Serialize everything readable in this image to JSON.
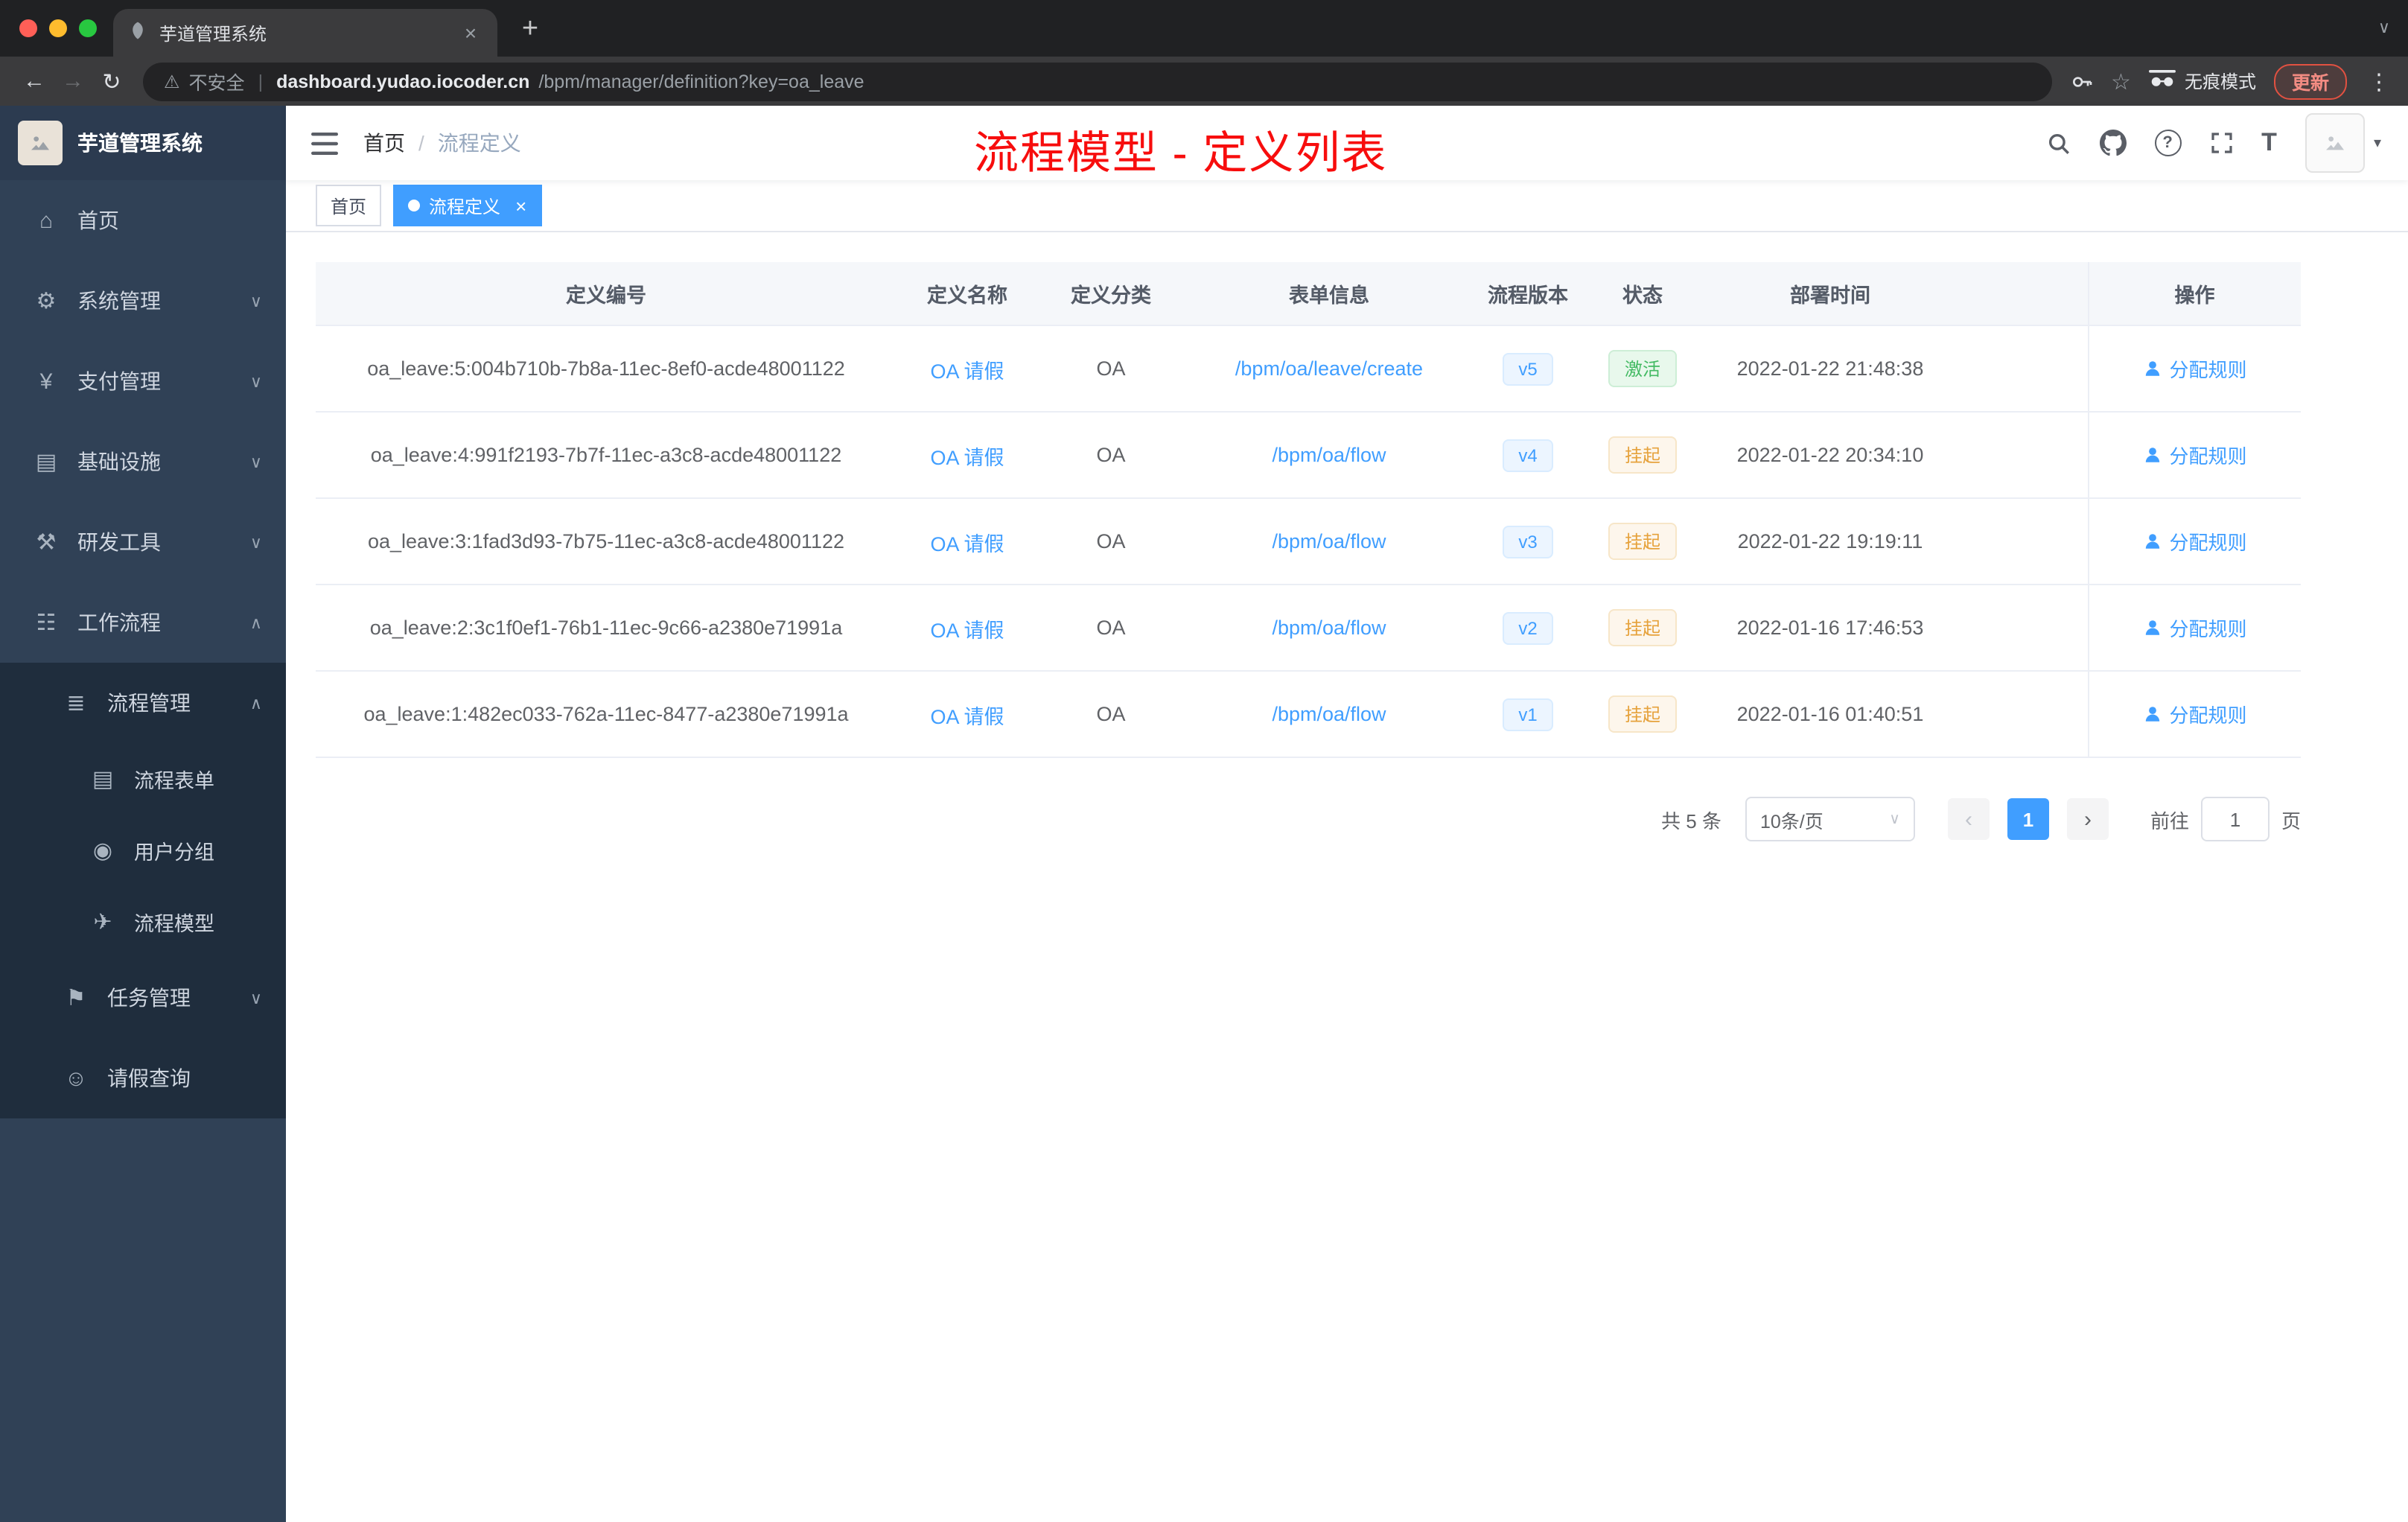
{
  "browser": {
    "tab_title": "芋道管理系统",
    "security_label": "不安全",
    "url_domain": "dashboard.yudao.iocoder.cn",
    "url_path": "/bpm/manager/definition?key=oa_leave",
    "incognito_label": "无痕模式",
    "update_label": "更新"
  },
  "icons": {
    "back": "←",
    "forward": "→",
    "reload": "↻",
    "warning": "⚠",
    "star": "☆",
    "kebab": "⋮",
    "close": "×",
    "plus": "+",
    "tab_chevron": "∨",
    "question": "?",
    "font_size": "T",
    "avatar_caret": "▾",
    "pager_prev": "‹",
    "pager_next": "›",
    "select_caret": "∨"
  },
  "sidebar": {
    "logo_title": "芋道管理系统",
    "items": [
      {
        "label": "首页",
        "icon": "⌂",
        "chevron": ""
      },
      {
        "label": "系统管理",
        "icon": "⚙",
        "chevron": "∨"
      },
      {
        "label": "支付管理",
        "icon": "¥",
        "chevron": "∨"
      },
      {
        "label": "基础设施",
        "icon": "▤",
        "chevron": "∨"
      },
      {
        "label": "研发工具",
        "icon": "⚒",
        "chevron": "∨"
      },
      {
        "label": "工作流程",
        "icon": "☷",
        "chevron": "∧"
      },
      {
        "label": "流程管理",
        "icon": "≣",
        "chevron": "∧"
      },
      {
        "label": "流程表单",
        "icon": "▤",
        "chevron": ""
      },
      {
        "label": "用户分组",
        "icon": "◉",
        "chevron": ""
      },
      {
        "label": "流程模型",
        "icon": "✈",
        "chevron": ""
      },
      {
        "label": "任务管理",
        "icon": "⚑",
        "chevron": "∨"
      },
      {
        "label": "请假查询",
        "icon": "☺",
        "chevron": ""
      }
    ]
  },
  "navbar": {
    "breadcrumb_home": "首页",
    "breadcrumb_sep": "/",
    "breadcrumb_current": "流程定义",
    "annotation": "流程模型 - 定义列表"
  },
  "tags": {
    "home": "首页",
    "active": "流程定义"
  },
  "table": {
    "columns": [
      "定义编号",
      "定义名称",
      "定义分类",
      "表单信息",
      "流程版本",
      "状态",
      "部署时间",
      "操作"
    ],
    "rows": [
      {
        "id": "oa_leave:5:004b710b-7b8a-11ec-8ef0-acde48001122",
        "name": "OA 请假",
        "category": "OA",
        "form": "/bpm/oa/leave/create",
        "version": "v5",
        "status": "激活",
        "status_type": "success",
        "time": "2022-01-22 21:48:38",
        "action": "分配规则"
      },
      {
        "id": "oa_leave:4:991f2193-7b7f-11ec-a3c8-acde48001122",
        "name": "OA 请假",
        "category": "OA",
        "form": "/bpm/oa/flow",
        "version": "v4",
        "status": "挂起",
        "status_type": "warning",
        "time": "2022-01-22 20:34:10",
        "action": "分配规则"
      },
      {
        "id": "oa_leave:3:1fad3d93-7b75-11ec-a3c8-acde48001122",
        "name": "OA 请假",
        "category": "OA",
        "form": "/bpm/oa/flow",
        "version": "v3",
        "status": "挂起",
        "status_type": "warning",
        "time": "2022-01-22 19:19:11",
        "action": "分配规则"
      },
      {
        "id": "oa_leave:2:3c1f0ef1-76b1-11ec-9c66-a2380e71991a",
        "name": "OA 请假",
        "category": "OA",
        "form": "/bpm/oa/flow",
        "version": "v2",
        "status": "挂起",
        "status_type": "warning",
        "time": "2022-01-16 17:46:53",
        "action": "分配规则"
      },
      {
        "id": "oa_leave:1:482ec033-762a-11ec-8477-a2380e71991a",
        "name": "OA 请假",
        "category": "OA",
        "form": "/bpm/oa/flow",
        "version": "v1",
        "status": "挂起",
        "status_type": "warning",
        "time": "2022-01-16 01:40:51",
        "action": "分配规则"
      }
    ]
  },
  "pagination": {
    "total": "共 5 条",
    "page_size": "10条/页",
    "page": "1",
    "goto_prefix": "前往",
    "goto_value": "1",
    "goto_suffix": "页"
  },
  "colors": {
    "accent": "#409eff",
    "sidebar_bg": "#304156",
    "submenu_bg": "#1f2d3d",
    "annotation_red": "#f70d0d",
    "success": "#43ba63",
    "warning": "#e6a23c"
  }
}
